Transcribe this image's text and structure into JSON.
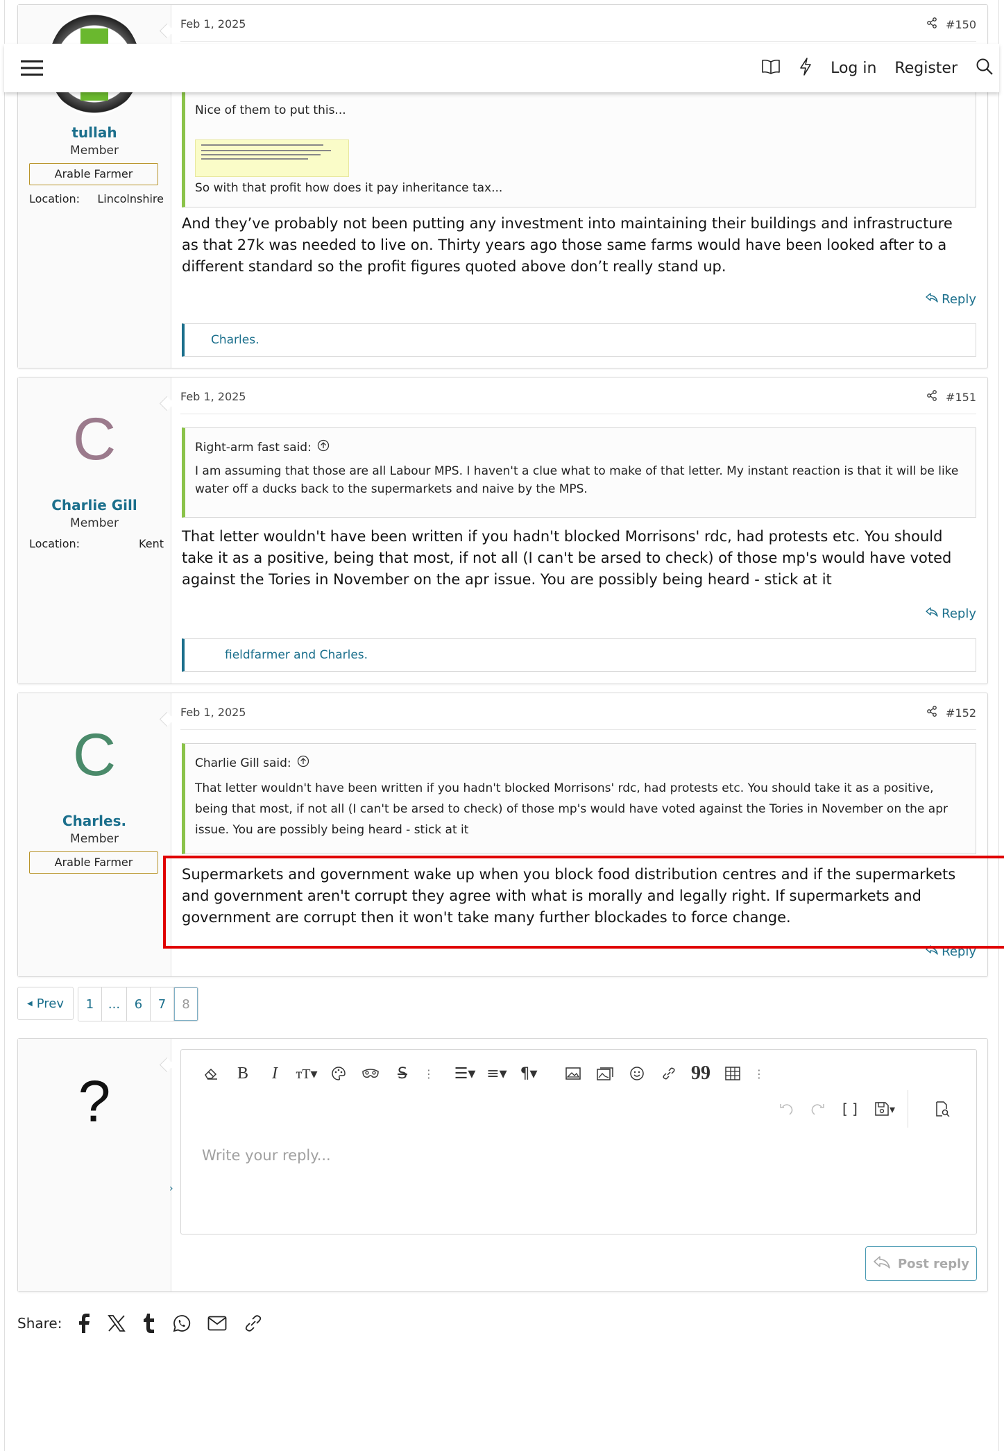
{
  "header": {
    "whats_new_icon": "book-icon",
    "latest_icon": "bolt-icon",
    "login_label": "Log in",
    "register_label": "Register",
    "search_icon": "search-icon"
  },
  "posts": [
    {
      "date": "Feb 1, 2025",
      "number": "#150",
      "username": "tullah",
      "user_title": "Member",
      "banner": "Arable Farmer",
      "location_label": "Location:",
      "location_value": "Lincolnshire",
      "quote_lines": [
        "Nice of them to put this...",
        "So with that profit how does it pay inheritance tax..."
      ],
      "body": "And they’ve probably not been putting any investment into maintaining their buildings and infrastructure as that 27k was needed to live on. Thirty years ago those same farms would have been looked after to a different standard so the profit figures quoted above don’t really stand up.",
      "reply_label": "Reply",
      "reactions": "Charles."
    },
    {
      "date": "Feb 1, 2025",
      "number": "#151",
      "avatar_letter": "C",
      "avatar_color": "#9b7a8c",
      "username": "Charlie Gill",
      "user_title": "Member",
      "location_label": "Location:",
      "location_value": "Kent",
      "quote_author": "Right-arm fast said:",
      "quote_text": "I am assuming that those are all Labour MPS. I haven't a clue what to make of that letter. My instant reaction is that it will be like water off a ducks back to the supermarkets and naive by the MPS.",
      "body": "That letter wouldn't have been written if you hadn't blocked Morrisons' rdc, had protests etc. You should take it as a positive, being that most, if not all (I can't be arsed to check) of those mp's would have voted against the Tories in November on the apr issue. You are possibly being heard - stick at it",
      "reply_label": "Reply",
      "reactions": "fieldfarmer and Charles."
    },
    {
      "date": "Feb 1, 2025",
      "number": "#152",
      "avatar_letter": "C",
      "avatar_color": "#4a8a6a",
      "username": "Charles.",
      "user_title": "Member",
      "banner": "Arable Farmer",
      "quote_author": "Charlie Gill said:",
      "quote_text": "That letter wouldn't have been written if you hadn't blocked Morrisons' rdc, had protests etc. You should take it as a positive, being that most, if not all (I can't be arsed to check) of those mp's would have voted against the Tories in November on the apr issue. You are possibly being heard - stick at it",
      "body": "Supermarkets and government wake up when you block food distribution centres and if the supermarkets and government aren't corrupt they agree with what is morally and legally right. If supermarkets and government are corrupt then it won't take many further blockades to force change.",
      "reply_label": "Reply"
    }
  ],
  "pagination": {
    "prev_label": "Prev",
    "pages": [
      "1",
      "...",
      "6",
      "7",
      "8"
    ],
    "current": "8"
  },
  "reply_box": {
    "avatar_letter": "?",
    "placeholder": "Write your reply...",
    "post_label": "Post reply"
  },
  "share": {
    "label": "Share:",
    "icons": [
      "facebook-icon",
      "x-icon",
      "tumblr-icon",
      "whatsapp-icon",
      "email-icon",
      "link-icon"
    ]
  },
  "colors": {
    "link": "#1b6f8c",
    "quote_bar": "#8bc34a",
    "banner_border": "#b8942a",
    "highlight": "#e00000"
  }
}
